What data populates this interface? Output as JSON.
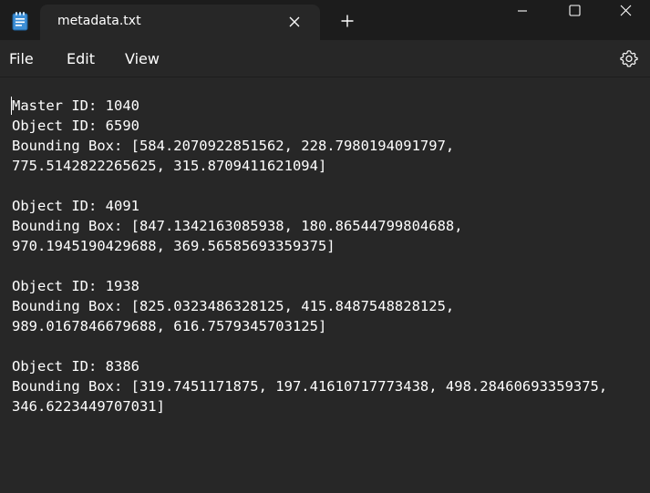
{
  "tab": {
    "title": "metadata.txt",
    "close_icon": "close-icon",
    "new_tab_icon": "plus-icon"
  },
  "window_controls": {
    "minimize_icon": "minimize-icon",
    "maximize_icon": "maximize-icon",
    "close_icon": "close-icon"
  },
  "menu": {
    "file": "File",
    "edit": "Edit",
    "view": "View",
    "settings_icon": "gear-icon"
  },
  "editor": {
    "lines": [
      "Master ID: 1040",
      "Object ID: 6590",
      "Bounding Box: [584.2070922851562, 228.7980194091797,",
      "775.5142822265625, 315.8709411621094]",
      "",
      "Object ID: 4091",
      "Bounding Box: [847.1342163085938, 180.86544799804688,",
      "970.1945190429688, 369.56585693359375]",
      "",
      "Object ID: 1938",
      "Bounding Box: [825.0323486328125, 415.8487548828125,",
      "989.0167846679688, 616.7579345703125]",
      "",
      "Object ID: 8386",
      "Bounding Box: [319.7451171875, 197.41610717773438, 498.28460693359375,",
      "346.6223449707031]"
    ]
  },
  "colors": {
    "titlebar": "#1c1c1c",
    "background": "#272727",
    "text": "#ffffff",
    "app_icon": "#3d8fd6"
  }
}
